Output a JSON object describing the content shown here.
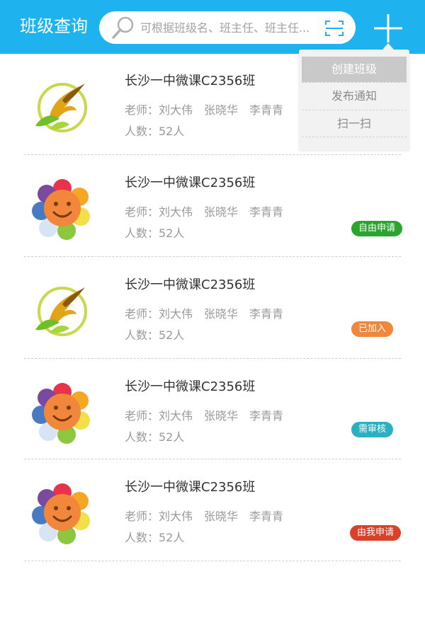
{
  "header": {
    "title": "班级查询",
    "search_placeholder": "可根据班级名、班主任、班主任...",
    "search_icon": "search-icon",
    "scan_icon": "scan-icon",
    "add_icon": "plus-icon",
    "bg_color": "#1eb3ef"
  },
  "dropdown": {
    "items": [
      {
        "label": "创建班级",
        "active": true
      },
      {
        "label": "发布通知",
        "active": false
      },
      {
        "label": "扫一扫",
        "active": false
      }
    ]
  },
  "classes": [
    {
      "name": "长沙一中微课C2356班",
      "teachers": "老师：刘大伟　张晓华　李青青",
      "count": "人数：52人",
      "logo": "phoenix-logo",
      "badge": null
    },
    {
      "name": "长沙一中微课C2356班",
      "teachers": "老师：刘大伟　张晓华　李青青",
      "count": "人数：52人",
      "logo": "flower-logo",
      "badge": {
        "label": "自由申请",
        "color": "#2aa52e"
      }
    },
    {
      "name": "长沙一中微课C2356班",
      "teachers": "老师：刘大伟　张晓华　李青青",
      "count": "人数：52人",
      "logo": "phoenix-logo",
      "badge": {
        "label": "已加入",
        "color": "#f0873a"
      }
    },
    {
      "name": "长沙一中微课C2356班",
      "teachers": "老师：刘大伟　张晓华　李青青",
      "count": "人数：52人",
      "logo": "flower-logo",
      "badge": {
        "label": "需审核",
        "color": "#2ab0c0"
      }
    },
    {
      "name": "长沙一中微课C2356班",
      "teachers": "老师：刘大伟　张晓华　李青青",
      "count": "人数：52人",
      "logo": "flower-logo",
      "badge": {
        "label": "由我申请",
        "color": "#d9412b"
      }
    }
  ]
}
